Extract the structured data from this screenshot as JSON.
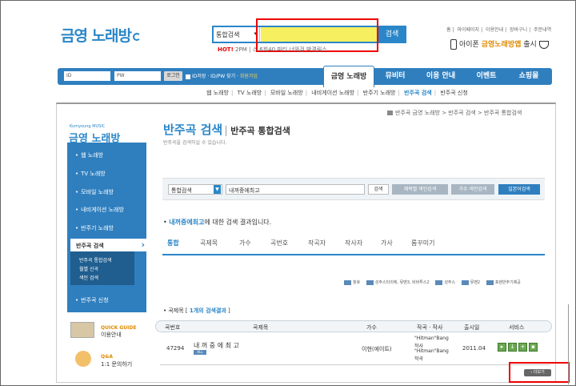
{
  "header": {
    "logo": "금영 노래방",
    "search": {
      "category": "통합검색",
      "value": "",
      "button": "검색"
    },
    "hot_label": "HOT!",
    "hot_links": [
      "2PM",
      "|",
      "스",
      "6회40",
      "파티 너와걸",
      "박경림스"
    ],
    "util_links": [
      "홈",
      "마이페이지",
      "이용안내",
      "장바구니",
      "주문내역"
    ],
    "promo_prefix": "아이폰",
    "promo_brand": "금영노래방앱",
    "promo_suffix": "출시"
  },
  "nav": {
    "id_placeholder": "ID",
    "pw_placeholder": "PW",
    "login_button": "로그인",
    "save_id": "ID저장",
    "find": "· ID/PW 찾기 ·",
    "join": "회원가입",
    "items": [
      "금영 노래방",
      "뮤비터",
      "이용 안내",
      "이벤트",
      "쇼핑몰"
    ]
  },
  "subnav": [
    "웹 노래방",
    "TV 노래방",
    "모바일 노래방",
    "내비게이션 노래방",
    "반주기 노래방",
    "반주곡 검색",
    "반주곡 신청"
  ],
  "sidebar": {
    "brand_sub": "Kumyoung MUSIC",
    "brand": "금영 노래방",
    "items": [
      "웹 노래방",
      "TV 노래방",
      "모바일 노래방",
      "내비게이션 노래방",
      "반주기 노래방"
    ],
    "active": "반주곡 검색",
    "sub_items": [
      "반주곡 통합검색",
      "월별 신곡",
      "색인 검색"
    ],
    "last_item": "반주곡 신청",
    "quick_guide_en": "QUICK GUIDE",
    "quick_guide": "이용안내",
    "qa_en": "Q&A",
    "qa": "1:1 문의하기"
  },
  "main": {
    "breadcrumb": "반주곡 금영 노래방 > 반주곡 검색 > 반주곡 통합검색",
    "title": "반주곡 검색",
    "subtitle": "반주곡 통합검색",
    "description": "반주곡을 검색하실 수 있습니다.",
    "search_box": {
      "category": "통합검색",
      "value": "내꺼중에최고",
      "btn_search": "검색",
      "btn_title_index": "제목별 색인검색",
      "btn_singer_index": "가수 색인검색",
      "btn_japanese": "일본어검색"
    },
    "result_keyword": "내꺼중에최고",
    "result_suffix": "에 대한 검색 결과입니다.",
    "tabs": [
      "통합",
      "곡제목",
      "가수",
      "곡번호",
      "작곡자",
      "작사자",
      "가사",
      "롬꾸미기"
    ],
    "legend": [
      "창호",
      "성주스티이에, 뮤멘3, 비바투스2",
      "성주스",
      "뮤멘2",
      "포렌반주기제공"
    ],
    "section_label": "곡제목",
    "section_count": "1개의 검색결과",
    "table": {
      "headers": [
        "곡번호",
        "곡제목",
        "가수",
        "작곡 · 작사",
        "출시일",
        "서비스"
      ],
      "rows": [
        {
          "number": "47294",
          "title": "내 꺼 중 에 최 고",
          "badge": "ALL",
          "singer": "이현(에이트)",
          "composer1": "\"Hitman\"Bang",
          "composer1b": "작사",
          "composer2": "\"Hitman\"Bang",
          "composer2b": "작곡",
          "date": "2011.04"
        }
      ]
    },
    "more_button": "더보기"
  }
}
